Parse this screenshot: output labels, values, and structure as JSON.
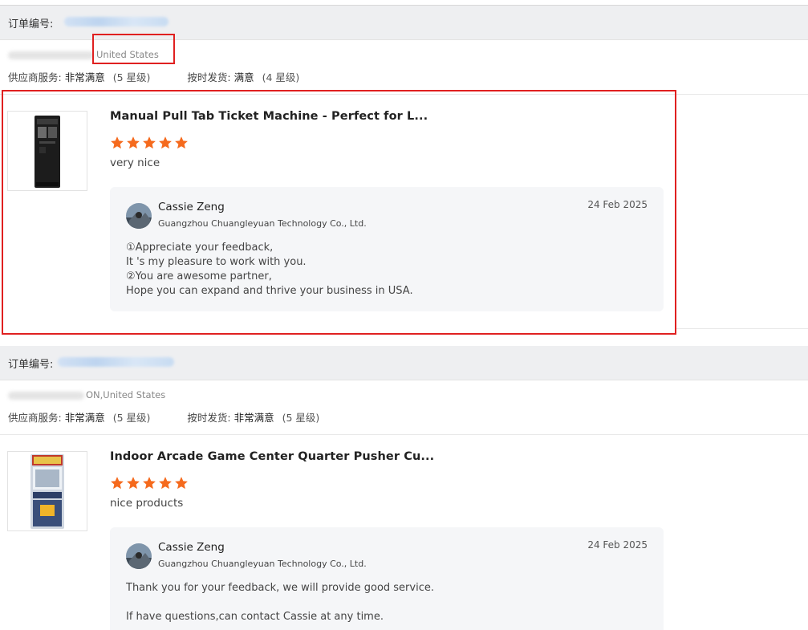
{
  "orders": [
    {
      "order_label": "订单编号:",
      "location": "United States",
      "ratings": {
        "supplier_label": "供应商服务:",
        "supplier_value": "非常满意",
        "supplier_level": "(5 星级)",
        "shipping_label": "按时发货:",
        "shipping_value": "满意",
        "shipping_level": "(4 星级)"
      },
      "product": {
        "title": "Manual Pull Tab Ticket Machine - Perfect for L...",
        "stars": 5,
        "review": "very nice"
      },
      "reply": {
        "name": "Cassie Zeng",
        "company": "Guangzhou Chuangleyuan Technology Co., Ltd.",
        "date": "24 Feb 2025",
        "lines": [
          "①Appreciate your  feedback,",
          "It 's my pleasure to work with you.",
          "②You are awesome partner,",
          "Hope you can expand and thrive your business in USA."
        ]
      }
    },
    {
      "order_label": "订单编号:",
      "location": "ON,United States",
      "ratings": {
        "supplier_label": "供应商服务:",
        "supplier_value": "非常满意",
        "supplier_level": "(5 星级)",
        "shipping_label": "按时发货:",
        "shipping_value": "非常满意",
        "shipping_level": "(5 星级)"
      },
      "product": {
        "title": "Indoor Arcade Game Center Quarter Pusher Cu...",
        "stars": 5,
        "review": "nice products"
      },
      "reply": {
        "name": "Cassie Zeng",
        "company": "Guangzhou Chuangleyuan Technology Co., Ltd.",
        "date": "24 Feb 2025",
        "lines": [
          "Thank you for your feedback, we will provide good service.",
          "",
          "If have questions,can contact Cassie at any time."
        ]
      }
    }
  ],
  "colors": {
    "star": "#f56a1d",
    "highlight": "#e02020",
    "order_bar": "#eeeff1",
    "reply_bg": "#f5f6f8"
  }
}
